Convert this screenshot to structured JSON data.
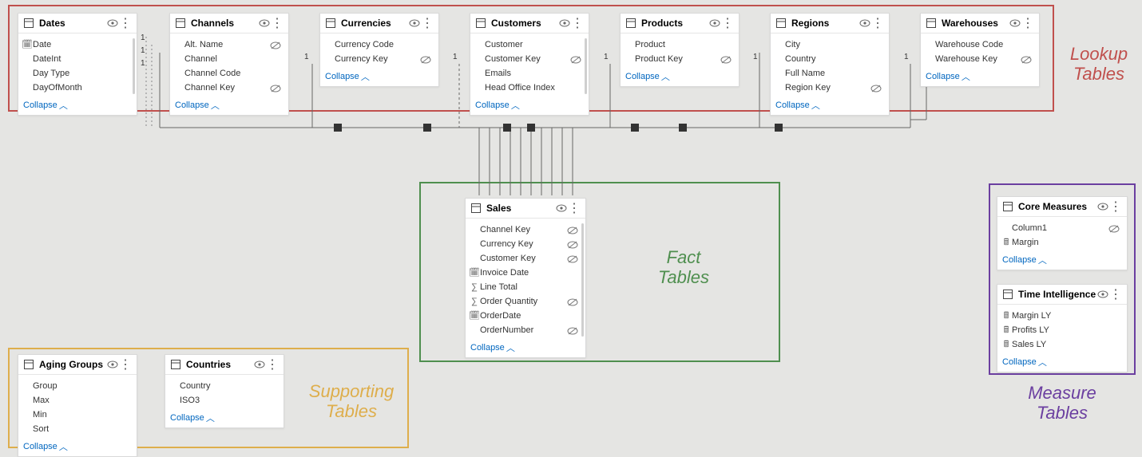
{
  "collapse_label": "Collapse",
  "groups": {
    "lookup": {
      "label": "Lookup\nTables",
      "color": "#c0504d",
      "labelColor": "#c0504d"
    },
    "fact": {
      "label": "Fact\nTables",
      "color": "#4f8f4f",
      "labelColor": "#4f8f4f"
    },
    "supporting": {
      "label": "Supporting\nTables",
      "color": "#deae4c",
      "labelColor": "#deae4c"
    },
    "measure": {
      "label": "Measure\nTables",
      "color": "#6b3fa0",
      "labelColor": "#6b3fa0"
    }
  },
  "tables": {
    "dates": {
      "title": "Dates",
      "fields": [
        {
          "name": "Date",
          "icon": "calendar"
        },
        {
          "name": "DateInt"
        },
        {
          "name": "Day Type"
        },
        {
          "name": "DayOfMonth"
        }
      ]
    },
    "channels": {
      "title": "Channels",
      "fields": [
        {
          "name": "Alt. Name",
          "hidden": true
        },
        {
          "name": "Channel"
        },
        {
          "name": "Channel Code"
        },
        {
          "name": "Channel Key",
          "hidden": true
        }
      ]
    },
    "currencies": {
      "title": "Currencies",
      "fields": [
        {
          "name": "Currency Code"
        },
        {
          "name": "Currency Key",
          "hidden": true
        }
      ]
    },
    "customers": {
      "title": "Customers",
      "fields": [
        {
          "name": "Customer"
        },
        {
          "name": "Customer Key",
          "hidden": true
        },
        {
          "name": "Emails"
        },
        {
          "name": "Head Office Index"
        }
      ]
    },
    "products": {
      "title": "Products",
      "fields": [
        {
          "name": "Product"
        },
        {
          "name": "Product Key",
          "hidden": true
        }
      ]
    },
    "regions": {
      "title": "Regions",
      "fields": [
        {
          "name": "City"
        },
        {
          "name": "Country"
        },
        {
          "name": "Full Name"
        },
        {
          "name": "Region Key",
          "hidden": true
        }
      ]
    },
    "warehouses": {
      "title": "Warehouses",
      "fields": [
        {
          "name": "Warehouse Code"
        },
        {
          "name": "Warehouse Key",
          "hidden": true
        }
      ]
    },
    "sales": {
      "title": "Sales",
      "fields": [
        {
          "name": "Channel Key",
          "hidden": true
        },
        {
          "name": "Currency Key",
          "hidden": true
        },
        {
          "name": "Customer Key",
          "hidden": true
        },
        {
          "name": "Invoice Date",
          "icon": "calendar"
        },
        {
          "name": "Line Total",
          "icon": "sigma"
        },
        {
          "name": "Order Quantity",
          "icon": "sigma",
          "hidden": true
        },
        {
          "name": "OrderDate",
          "icon": "calendar"
        },
        {
          "name": "OrderNumber",
          "hidden": true
        }
      ]
    },
    "aging": {
      "title": "Aging Groups",
      "fields": [
        {
          "name": "Group"
        },
        {
          "name": "Max"
        },
        {
          "name": "Min"
        },
        {
          "name": "Sort"
        }
      ]
    },
    "countries": {
      "title": "Countries",
      "fields": [
        {
          "name": "Country"
        },
        {
          "name": "ISO3"
        }
      ]
    },
    "core": {
      "title": "Core Measures",
      "fields": [
        {
          "name": "Column1",
          "hidden": true
        },
        {
          "name": "Margin",
          "icon": "calc"
        }
      ]
    },
    "timeintel": {
      "title": "Time Intelligence",
      "fields": [
        {
          "name": "Margin LY",
          "icon": "calc"
        },
        {
          "name": "Profits LY",
          "icon": "calc"
        },
        {
          "name": "Sales LY",
          "icon": "calc"
        }
      ]
    }
  },
  "cardinality_one": "1"
}
